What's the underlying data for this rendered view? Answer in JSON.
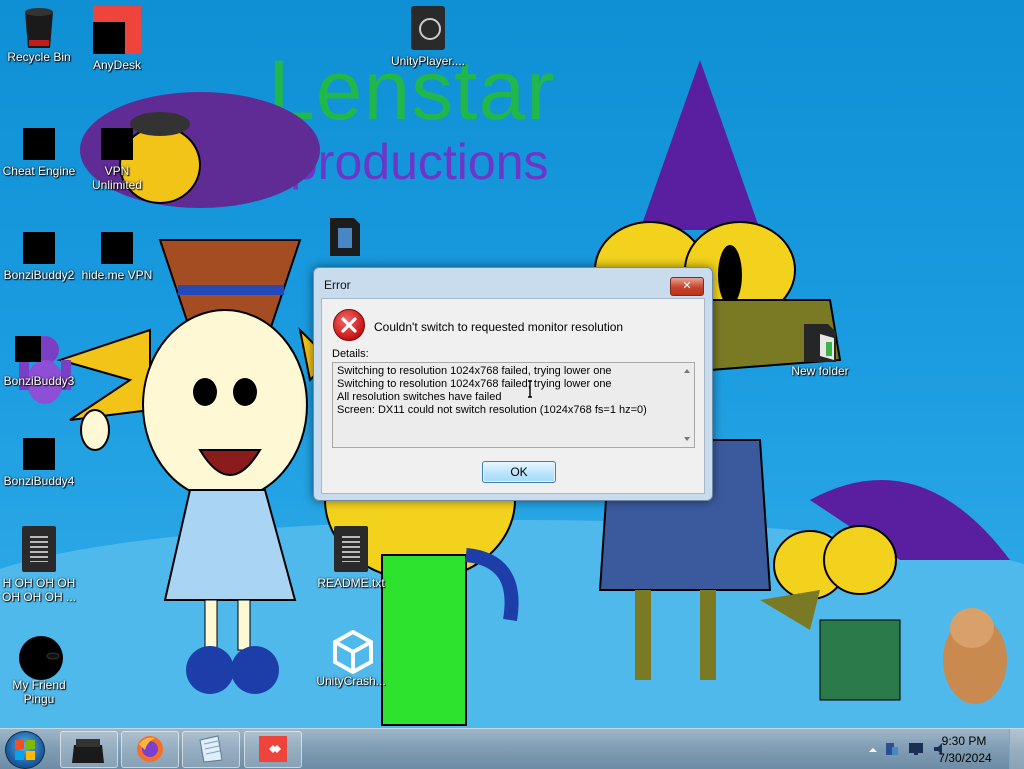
{
  "wallpaper": {
    "title": "Lenstar",
    "subtitle": "productions"
  },
  "desktop_icons": [
    {
      "key": "recycle-bin",
      "label": "Recycle Bin"
    },
    {
      "key": "anydesk",
      "label": "AnyDesk"
    },
    {
      "key": "unityplayer",
      "label": "UnityPlayer...."
    },
    {
      "key": "cheat-engine",
      "label": "Cheat Engine"
    },
    {
      "key": "vpn-unlimited",
      "label": "VPN Unlimited"
    },
    {
      "key": "bonzibuddy2",
      "label": "BonziBuddy2"
    },
    {
      "key": "hideme-vpn",
      "label": "hide.me VPN"
    },
    {
      "key": "bonzibuddy3",
      "label": "BonziBuddy3"
    },
    {
      "key": "new-folder",
      "label": "New folder"
    },
    {
      "key": "bonzibuddy4",
      "label": "BonziBuddy4"
    },
    {
      "key": "oh-file",
      "label": "H OH OH OH OH OH OH ..."
    },
    {
      "key": "readme",
      "label": "README.txt"
    },
    {
      "key": "my-friend-pingu",
      "label": "My Friend Pingu"
    },
    {
      "key": "unitycrash",
      "label": "UnityCrash..."
    }
  ],
  "dialog": {
    "title": "Error",
    "close_glyph": "✕",
    "message": "Couldn't switch to requested monitor resolution",
    "details_label": "Details:",
    "details_lines": [
      "Switching to resolution 1024x768 failed, trying lower one",
      "Switching to resolution 1024x768 failed, trying lower one",
      "All resolution switches have failed",
      "Screen: DX11 could not switch resolution (1024x768 fs=1 hz=0)"
    ],
    "ok_label": "OK"
  },
  "taskbar": {
    "pinned": [
      "file-explorer-icon",
      "firefox-icon",
      "notepad-icon",
      "anydesk-icon"
    ],
    "clock_time": "9:30 PM",
    "clock_date": "7/30/2024"
  },
  "colors": {
    "wallpaper_sky": "#1a9be0",
    "title_green": "#20b84a",
    "subtitle_purple": "#6d35c8",
    "error_red": "#c71414"
  }
}
